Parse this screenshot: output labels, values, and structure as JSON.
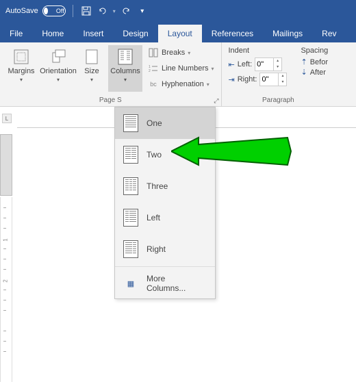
{
  "titlebar": {
    "autosave_label": "AutoSave",
    "autosave_state": "Off"
  },
  "tabs": {
    "file": "File",
    "home": "Home",
    "insert": "Insert",
    "design": "Design",
    "layout": "Layout",
    "references": "References",
    "mailings": "Mailings",
    "review": "Rev"
  },
  "ribbon": {
    "page_setup": {
      "margins": "Margins",
      "orientation": "Orientation",
      "size": "Size",
      "columns": "Columns",
      "breaks": "Breaks",
      "line_numbers": "Line Numbers",
      "hyphenation": "Hyphenation",
      "group_name": "Page S"
    },
    "paragraph": {
      "indent_header": "Indent",
      "spacing_header": "Spacing",
      "left_label": "Left:",
      "right_label": "Right:",
      "left_value": "0\"",
      "right_value": "0\"",
      "before_label": "Befor",
      "after_label": "After",
      "group_name": "Paragraph"
    }
  },
  "columns_menu": {
    "one": "One",
    "two": "Two",
    "three": "Three",
    "left": "Left",
    "right": "Right",
    "more": "More Columns..."
  },
  "ruler": {
    "corner": "L",
    "marks": [
      "1",
      "2"
    ]
  }
}
